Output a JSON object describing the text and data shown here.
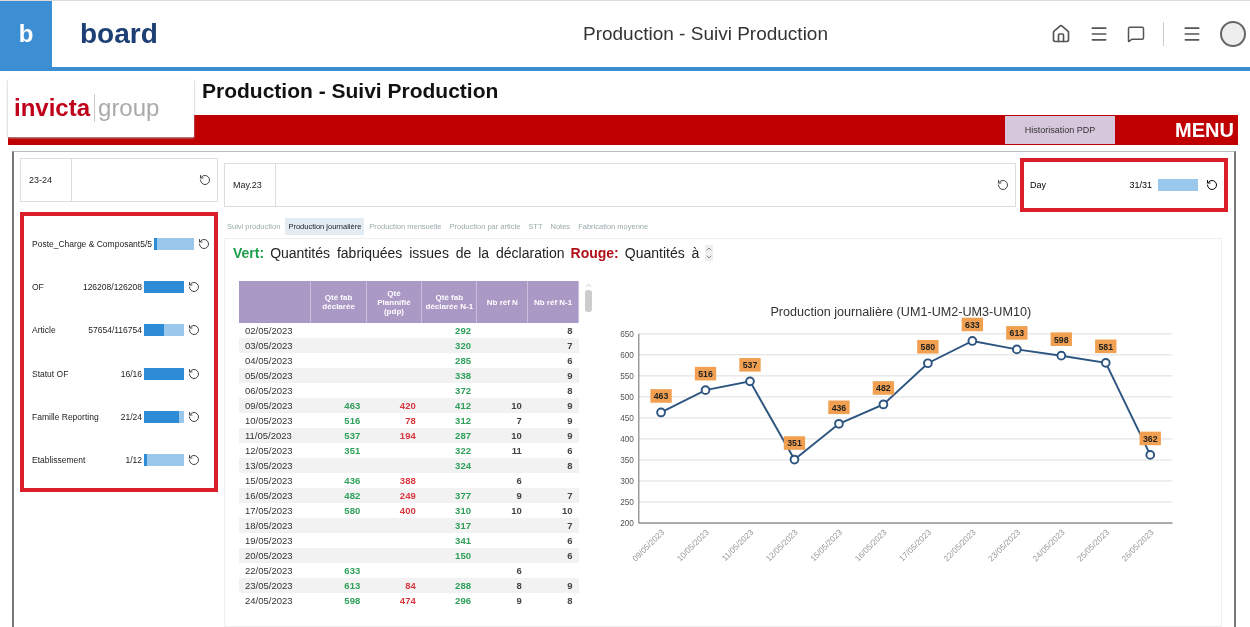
{
  "app_bar": {
    "logo_mark": "b",
    "brand": "board",
    "title": "Production - Suivi Production"
  },
  "header": {
    "logo": {
      "main": "invicta",
      "secondary": "group"
    },
    "title": "Production - Suivi Production",
    "button": "Historisation PDP",
    "menu": "MENU"
  },
  "selectors": [
    {
      "value": "23-24"
    },
    {
      "value": "May.23"
    }
  ],
  "day_filter": {
    "label": "Day",
    "count": "31/31",
    "level": 0,
    "highlighted": true
  },
  "filters": {
    "highlighted": true,
    "items": [
      {
        "label": "Poste_Charge & Composant",
        "count": "5/5",
        "level": 0.08
      },
      {
        "label": "OF",
        "count": "126208/126208",
        "level": 1
      },
      {
        "label": "Article",
        "count": "57654/116754",
        "level": 0.5
      },
      {
        "label": "Statut OF",
        "count": "16/16",
        "level": 1
      },
      {
        "label": "Famille Reporting",
        "count": "21/24",
        "level": 0.88
      },
      {
        "label": "Etablissement",
        "count": "1/12",
        "level": 0.08
      }
    ]
  },
  "tabs": [
    {
      "label": "Suivi production",
      "selected": false
    },
    {
      "label": "Production journalière",
      "selected": true
    },
    {
      "label": "Production mensuelle",
      "selected": false
    },
    {
      "label": "Production par article",
      "selected": false
    },
    {
      "label": "STT",
      "selected": false
    },
    {
      "label": "Notes",
      "selected": false
    },
    {
      "label": "Fabrication moyenne",
      "selected": false
    }
  ],
  "legend": [
    {
      "label": "Vert:",
      "color": "#1e9e4a",
      "text": "Quantités fabriquées issues de la déclaration"
    },
    {
      "label": "Rouge:",
      "color": "#b0101a",
      "text": "Quantités à"
    }
  ],
  "table": {
    "columns": [
      {
        "kind": "date"
      },
      {
        "label": "Qté fab déclarée",
        "color": "#2ea05a"
      },
      {
        "label": "Qté Plannifié (pdp)",
        "color": "#d9363e"
      },
      {
        "label": "Qté fab déclarée N-1",
        "color": "#2ea05a"
      },
      {
        "label": "Nb réf N",
        "color": "#444444"
      },
      {
        "label": "Nb réf N-1",
        "color": "#444444"
      }
    ],
    "rows": [
      [
        "02/05/2023",
        "",
        "",
        "292",
        "",
        "8"
      ],
      [
        "03/05/2023",
        "",
        "",
        "320",
        "",
        "7"
      ],
      [
        "04/05/2023",
        "",
        "",
        "285",
        "",
        "6"
      ],
      [
        "05/05/2023",
        "",
        "",
        "338",
        "",
        "9"
      ],
      [
        "06/05/2023",
        "",
        "",
        "372",
        "",
        "8"
      ],
      [
        "09/05/2023",
        "463",
        "420",
        "412",
        "10",
        "9"
      ],
      [
        "10/05/2023",
        "516",
        "78",
        "312",
        "7",
        "9"
      ],
      [
        "11/05/2023",
        "537",
        "194",
        "287",
        "10",
        "9"
      ],
      [
        "12/05/2023",
        "351",
        "",
        "322",
        "11",
        "6"
      ],
      [
        "13/05/2023",
        "",
        "",
        "324",
        "",
        "8"
      ],
      [
        "15/05/2023",
        "436",
        "388",
        "",
        "6",
        ""
      ],
      [
        "16/05/2023",
        "482",
        "249",
        "377",
        "9",
        "7"
      ],
      [
        "17/05/2023",
        "580",
        "400",
        "310",
        "10",
        "10"
      ],
      [
        "18/05/2023",
        "",
        "",
        "317",
        "",
        "7"
      ],
      [
        "19/05/2023",
        "",
        "",
        "341",
        "",
        "6"
      ],
      [
        "20/05/2023",
        "",
        "",
        "150",
        "",
        "6"
      ],
      [
        "22/05/2023",
        "633",
        "",
        "",
        "6",
        ""
      ],
      [
        "23/05/2023",
        "613",
        "84",
        "288",
        "8",
        "9"
      ],
      [
        "24/05/2023",
        "598",
        "474",
        "296",
        "9",
        "8"
      ]
    ]
  },
  "chart": {
    "chart_data": {
      "type": "line",
      "title": "Production journalière (UM1-UM2-UM3-UM10)",
      "categories": [
        "09/05/2023",
        "10/05/2023",
        "11/05/2023",
        "12/05/2023",
        "15/05/2023",
        "16/05/2023",
        "17/05/2023",
        "22/05/2023",
        "23/05/2023",
        "24/05/2023",
        "25/05/2023",
        "26/05/2023"
      ],
      "grid": true,
      "series": [
        {
          "color": "#2d5580",
          "marker": "circle",
          "values": [
            463,
            516,
            537,
            351,
            436,
            482,
            580,
            633,
            613,
            598,
            581,
            362
          ]
        }
      ],
      "ylim": [
        200,
        650
      ],
      "yticks": [
        200,
        250,
        300,
        350,
        400,
        450,
        500,
        550,
        600,
        650
      ],
      "data_labels": true
    }
  }
}
